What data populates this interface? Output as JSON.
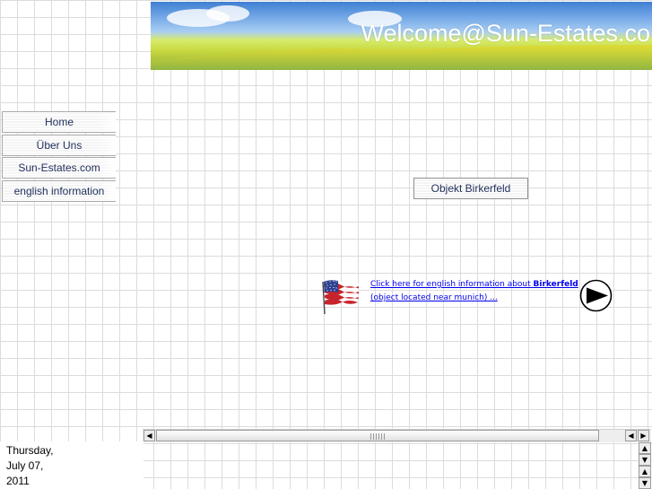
{
  "banner": {
    "title": "Welcome@Sun-Estates.co"
  },
  "nav": {
    "items": [
      {
        "label": "Home"
      },
      {
        "label": "Über Uns"
      },
      {
        "label": "Sun-Estates.com"
      },
      {
        "label": "english information"
      }
    ]
  },
  "main": {
    "object_button": "Objekt Birkerfeld",
    "info_link": {
      "line1_prefix": "Click here for english information about ",
      "line1_bold": "Birkerfeld",
      "line2": "(object located near munich) ..."
    }
  },
  "icons": {
    "flag": "us-flag-icon",
    "play": "play-arrow-icon"
  },
  "date": {
    "weekday": "Thursday,",
    "month_day": "July 07,",
    "year": "2011"
  },
  "scrollbar": {
    "left": "◀",
    "right": "▶",
    "up": "▲",
    "down": "▼"
  },
  "colors": {
    "nav_text": "#22325f",
    "link": "#0000ee",
    "grid": "#dcdcdc"
  }
}
